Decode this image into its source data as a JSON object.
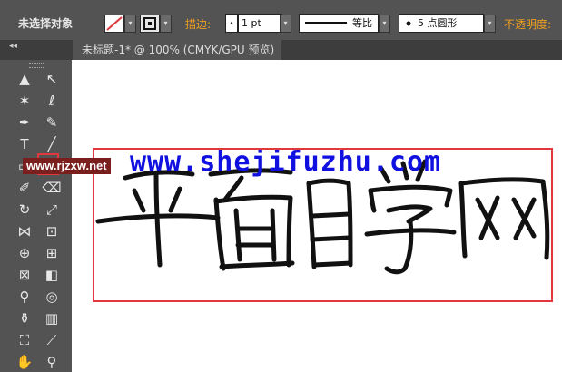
{
  "control_bar": {
    "selection_status": "未选择对象",
    "stroke_label": "描边:",
    "stroke_weight": "1 pt",
    "profile_label": "等比",
    "brush_label": "5 点圆形",
    "opacity_label": "不透明度:"
  },
  "document_tab": {
    "title": "未标题-1* @ 100% (CMYK/GPU 预览)",
    "collapse_glyph": "◂◂"
  },
  "canvas": {
    "watermark_text": "www.shejifuzhu.com",
    "site_tag": "www.rjzxw.net",
    "highlight_color": "#e0383d",
    "watermark_color": "#1010e0"
  },
  "tools": [
    {
      "name": "selection-tool",
      "glyph": "▲"
    },
    {
      "name": "direct-selection-tool",
      "glyph": "↖"
    },
    {
      "name": "magic-wand-tool",
      "glyph": "✶"
    },
    {
      "name": "lasso-tool",
      "glyph": "ℓ"
    },
    {
      "name": "pen-tool",
      "glyph": "✒"
    },
    {
      "name": "curvature-tool",
      "glyph": "✎"
    },
    {
      "name": "type-tool",
      "glyph": "T"
    },
    {
      "name": "line-segment-tool",
      "glyph": "╱"
    },
    {
      "name": "rectangle-tool",
      "glyph": "▭"
    },
    {
      "name": "paintbrush-tool",
      "glyph": "✏"
    },
    {
      "name": "pencil-tool",
      "glyph": "✐"
    },
    {
      "name": "eraser-tool",
      "glyph": "⌫"
    },
    {
      "name": "rotate-tool",
      "glyph": "↻"
    },
    {
      "name": "scale-tool",
      "glyph": "⤢"
    },
    {
      "name": "width-tool",
      "glyph": "⋈"
    },
    {
      "name": "free-transform-tool",
      "glyph": "⊡"
    },
    {
      "name": "shape-builder-tool",
      "glyph": "⊕"
    },
    {
      "name": "perspective-grid-tool",
      "glyph": "⊞"
    },
    {
      "name": "mesh-tool",
      "glyph": "⊠"
    },
    {
      "name": "gradient-tool",
      "glyph": "◧"
    },
    {
      "name": "eyedropper-tool",
      "glyph": "⚲"
    },
    {
      "name": "blend-tool",
      "glyph": "◎"
    },
    {
      "name": "symbol-sprayer-tool",
      "glyph": "⚱"
    },
    {
      "name": "column-graph-tool",
      "glyph": "▥"
    },
    {
      "name": "artboard-tool",
      "glyph": "⛶"
    },
    {
      "name": "slice-tool",
      "glyph": "⟋"
    },
    {
      "name": "hand-tool",
      "glyph": "✋"
    },
    {
      "name": "zoom-tool",
      "glyph": "⚲"
    }
  ]
}
